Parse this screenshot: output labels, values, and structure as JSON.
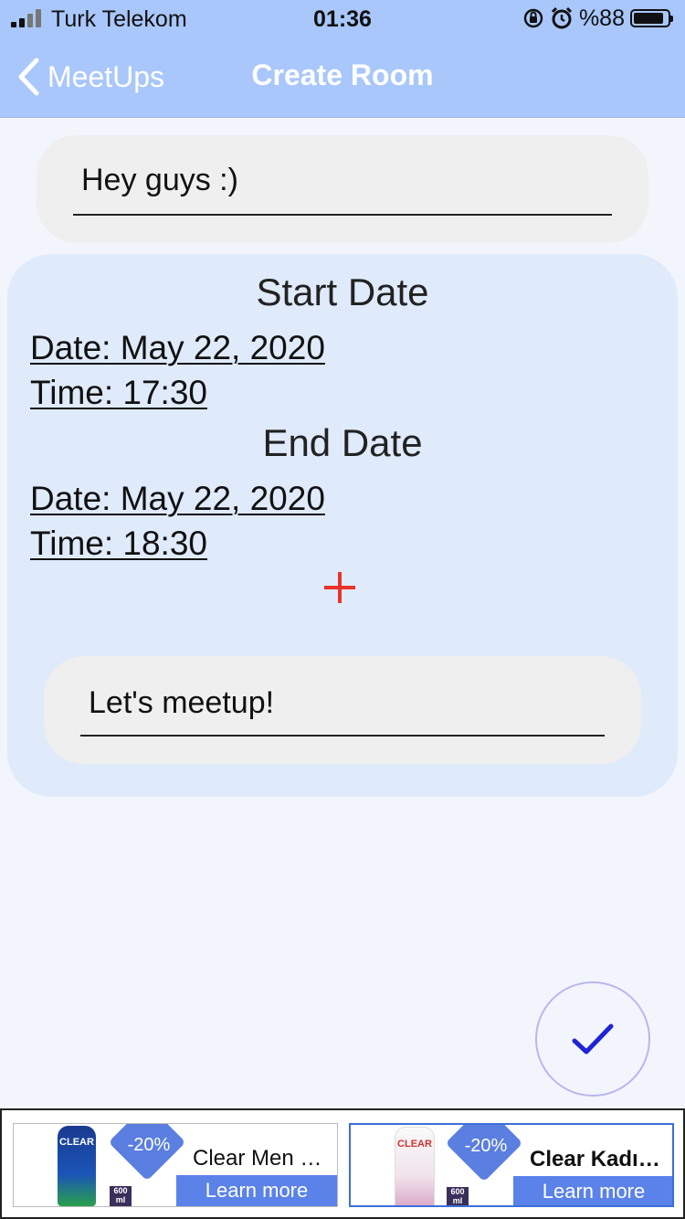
{
  "status_bar": {
    "carrier": "Turk Telekom",
    "time": "01:36",
    "battery": "%88",
    "battery_level": 0.88,
    "icons": [
      "signal-icon",
      "orientation-lock-icon",
      "alarm-icon",
      "battery-icon"
    ]
  },
  "nav": {
    "back_label": "MeetUps",
    "title": "Create Room"
  },
  "room": {
    "name": "Hey guys :)"
  },
  "schedule": {
    "start_heading": "Start Date",
    "start_date": "Date: May 22, 2020",
    "start_time": "Time: 17:30",
    "end_heading": "End Date",
    "end_date": "Date: May 22, 2020",
    "end_time": "Time: 18:30",
    "add_icon": "plus-icon",
    "message": "Let's meetup!"
  },
  "confirm": {
    "icon": "checkmark-icon"
  },
  "ads": [
    {
      "discount": "-20%",
      "title": "Clear Men C...",
      "button": "Learn more",
      "bottle_brand": "CLEAR",
      "volume": "600 ml"
    },
    {
      "discount": "-20%",
      "title": "Clear Kadınl...",
      "button": "Learn more",
      "bottle_brand": "CLEAR",
      "volume": "600 ml"
    }
  ],
  "colors": {
    "nav_bar": "#a9c7fb",
    "card": "#dfeafb",
    "plus": "#e8332a",
    "check": "#1f24d6",
    "ad_button": "#5a82e8"
  }
}
